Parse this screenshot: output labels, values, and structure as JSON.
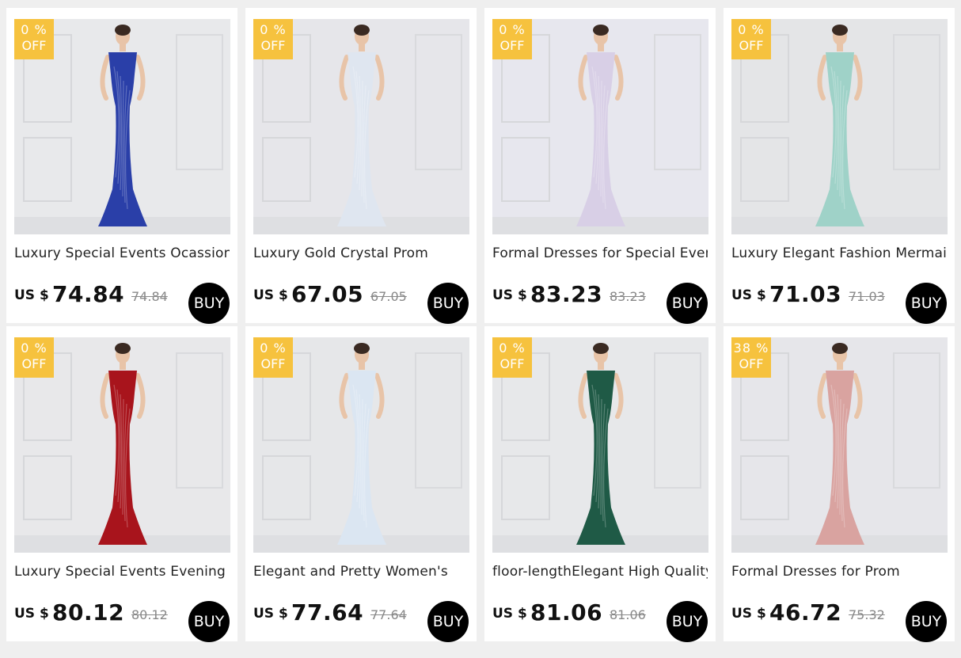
{
  "products": [
    {
      "discount_pct": "0  %",
      "discount_off": "OFF",
      "title": "Luxury Special Events Ocassion",
      "currency": "US $",
      "price": "74.84",
      "original_price": "74.84",
      "buy_label": "BUY",
      "dress_color": "#2a3fa8",
      "bg_color": "#e8e9eb",
      "image_icon": "product-photo-blue-sequin-gown"
    },
    {
      "discount_pct": "0  %",
      "discount_off": "OFF",
      "title": "Luxury Gold Crystal Prom",
      "currency": "US $",
      "price": "67.05",
      "original_price": "67.05",
      "buy_label": "BUY",
      "dress_color": "#dfe6f0",
      "bg_color": "#e6e6ea",
      "image_icon": "product-photo-iridescent-sequin-gown"
    },
    {
      "discount_pct": "0  %",
      "discount_off": "OFF",
      "title": "Formal Dresses for Special Events",
      "currency": "US $",
      "price": "83.23",
      "original_price": "83.23",
      "buy_label": "BUY",
      "dress_color": "#d8cfe6",
      "bg_color": "#e7e7ee",
      "image_icon": "product-photo-lilac-feather-gown"
    },
    {
      "discount_pct": "0  %",
      "discount_off": "OFF",
      "title": "Luxury Elegant Fashion Mermaid",
      "currency": "US $",
      "price": "71.03",
      "original_price": "71.03",
      "buy_label": "BUY",
      "dress_color": "#9fd2c8",
      "bg_color": "#e4e5e7",
      "image_icon": "product-photo-mint-sequin-gown"
    },
    {
      "discount_pct": "0  %",
      "discount_off": "OFF",
      "title": "Luxury Special Events Evening",
      "currency": "US $",
      "price": "80.12",
      "original_price": "80.12",
      "buy_label": "BUY",
      "dress_color": "#a8141c",
      "bg_color": "#e8e8ea",
      "image_icon": "product-photo-red-sequin-gown"
    },
    {
      "discount_pct": "0  %",
      "discount_off": "OFF",
      "title": "Elegant and Pretty Women's",
      "currency": "US $",
      "price": "77.64",
      "original_price": "77.64",
      "buy_label": "BUY",
      "dress_color": "#dbe6f2",
      "bg_color": "#e6e7e9",
      "image_icon": "product-photo-white-sequin-slit-gown"
    },
    {
      "discount_pct": "0  %",
      "discount_off": "OFF",
      "title": "floor-lengthElegant High Quality",
      "currency": "US $",
      "price": "81.06",
      "original_price": "81.06",
      "buy_label": "BUY",
      "dress_color": "#1f5a46",
      "bg_color": "#e7e8ea",
      "image_icon": "product-photo-green-sequin-gown"
    },
    {
      "discount_pct": "38  %",
      "discount_off": "OFF",
      "title": "Formal Dresses for Prom",
      "currency": "US $",
      "price": "46.72",
      "original_price": "75.32",
      "buy_label": "BUY",
      "dress_color": "#d9a3a0",
      "bg_color": "#e6e6ea",
      "image_icon": "product-photo-pink-sequin-gown"
    }
  ]
}
